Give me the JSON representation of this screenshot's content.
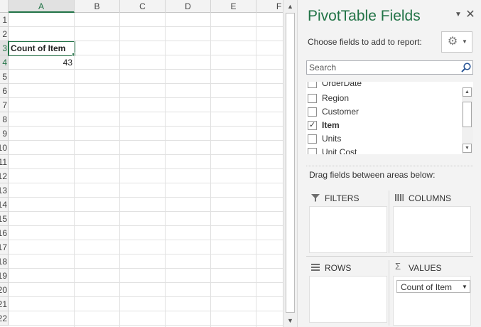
{
  "sheet": {
    "columns": [
      "A",
      "B",
      "C",
      "D",
      "E",
      "F"
    ],
    "rows": [
      "1",
      "2",
      "3",
      "4",
      "5",
      "6",
      "7",
      "8",
      "9",
      "10",
      "11",
      "12",
      "13",
      "14",
      "15",
      "16",
      "17",
      "18",
      "19",
      "20",
      "21",
      "22"
    ],
    "cells": {
      "a3": "Count of Item",
      "a4": "43"
    }
  },
  "panel": {
    "title": "PivotTable Fields",
    "choose_label": "Choose fields to add to report:",
    "search_placeholder": "Search",
    "fields": [
      {
        "label": "OrderDate",
        "checked": false
      },
      {
        "label": "Region",
        "checked": false
      },
      {
        "label": "Customer",
        "checked": false
      },
      {
        "label": "Item",
        "checked": true
      },
      {
        "label": "Units",
        "checked": false
      },
      {
        "label": "Unit Cost",
        "checked": false
      }
    ],
    "drag_label": "Drag fields between areas below:",
    "areas": {
      "filters": "FILTERS",
      "columns": "COLUMNS",
      "rows": "ROWS",
      "values": "VALUES"
    },
    "values_items": [
      "Count of Item"
    ]
  },
  "icons": {
    "close": "close-icon",
    "dropdown": "chevron-down-icon",
    "gear": "gear-icon",
    "search": "search-icon",
    "filter": "filter-icon",
    "columns": "columns-icon",
    "rows": "rows-icon",
    "sigma": "sigma-icon"
  },
  "colors": {
    "accent": "#217346"
  }
}
